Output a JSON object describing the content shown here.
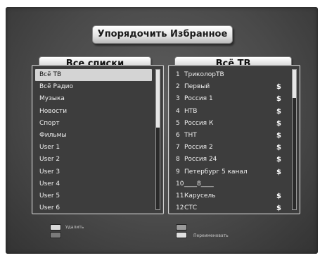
{
  "title": "Упорядочить Избранное",
  "left_panel": {
    "header": "Все списки",
    "items": [
      {
        "label": "Всё ТВ",
        "selected": true
      },
      {
        "label": "Всё Радио"
      },
      {
        "label": "Музыка"
      },
      {
        "label": "Новости"
      },
      {
        "label": "Спорт"
      },
      {
        "label": "Фильмы"
      },
      {
        "label": "User 1"
      },
      {
        "label": "User 2"
      },
      {
        "label": "User 3"
      },
      {
        "label": "User 4"
      },
      {
        "label": "User 5"
      },
      {
        "label": "User 6"
      }
    ]
  },
  "right_panel": {
    "header": "Всё ТВ",
    "channels": [
      {
        "num": "1",
        "name": "ТриколорТВ",
        "scrambled": ""
      },
      {
        "num": "2",
        "name": "Первый",
        "scrambled": "$"
      },
      {
        "num": "3",
        "name": "Россия 1",
        "scrambled": "$"
      },
      {
        "num": "4",
        "name": "НТВ",
        "scrambled": "$"
      },
      {
        "num": "5",
        "name": "Россия К",
        "scrambled": "$"
      },
      {
        "num": "6",
        "name": "ТНТ",
        "scrambled": "$"
      },
      {
        "num": "7",
        "name": "Россия 2",
        "scrambled": "$"
      },
      {
        "num": "8",
        "name": "Россия 24",
        "scrambled": "$"
      },
      {
        "num": "9",
        "name": "Петербург 5 канал",
        "scrambled": "$"
      },
      {
        "num": "10",
        "name": "____8____",
        "scrambled": ""
      },
      {
        "num": "11",
        "name": "Карусель",
        "scrambled": "$"
      },
      {
        "num": "12",
        "name": "СТС",
        "scrambled": "$"
      }
    ]
  },
  "footer": {
    "delete_label": "Удалить",
    "rename_label": "Переименовать"
  }
}
